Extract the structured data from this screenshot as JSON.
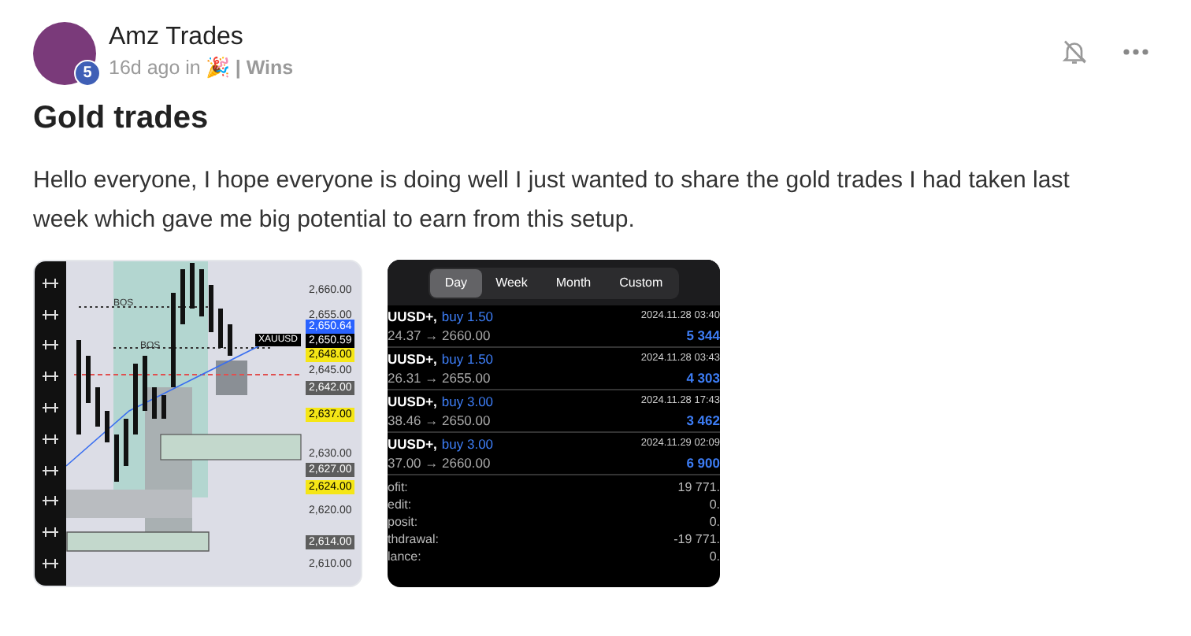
{
  "post": {
    "author": "Amz Trades",
    "level_badge": "5",
    "time": "16d ago in",
    "category_emoji": "🎉",
    "category": "| Wins",
    "title": "Gold trades",
    "body": "Hello everyone, I hope everyone is doing well I just wanted to share the gold trades I had taken last week which gave me big potential to earn from this setup."
  },
  "chart_image": {
    "annotations": [
      "BOS",
      "BOS"
    ],
    "symbol": "XAUUSD",
    "price_labels": [
      {
        "text": "2,660.00",
        "kind": "plain"
      },
      {
        "text": "2,655.00",
        "kind": "plain"
      },
      {
        "text": "2,650.64",
        "kind": "blue"
      },
      {
        "text": "2,650.59",
        "kind": "black"
      },
      {
        "text": "2,648.00",
        "kind": "yellow"
      },
      {
        "text": "2,645.00",
        "kind": "plain"
      },
      {
        "text": "2,642.00",
        "kind": "gray"
      },
      {
        "text": "2,637.00",
        "kind": "yellow"
      },
      {
        "text": "2,630.00",
        "kind": "plain"
      },
      {
        "text": "2,627.00",
        "kind": "gray"
      },
      {
        "text": "2,624.00",
        "kind": "yellow"
      },
      {
        "text": "2,620.00",
        "kind": "plain"
      },
      {
        "text": "2,614.00",
        "kind": "gray"
      },
      {
        "text": "2,610.00",
        "kind": "plain"
      }
    ]
  },
  "history_image": {
    "tabs": [
      {
        "label": "Day",
        "selected": true
      },
      {
        "label": "Week",
        "selected": false
      },
      {
        "label": "Month",
        "selected": false
      },
      {
        "label": "Custom",
        "selected": false
      }
    ],
    "trades": [
      {
        "symbol": "UUSD+,",
        "action": "buy 1.50",
        "time": "2024.11.28 03:40",
        "prices": "24.37 → 2660.00",
        "profit": "5 344"
      },
      {
        "symbol": "UUSD+,",
        "action": "buy 1.50",
        "time": "2024.11.28 03:43",
        "prices": "26.31 → 2655.00",
        "profit": "4 303"
      },
      {
        "symbol": "UUSD+,",
        "action": "buy 3.00",
        "time": "2024.11.28 17:43",
        "prices": "38.46 → 2650.00",
        "profit": "3 462"
      },
      {
        "symbol": "UUSD+,",
        "action": "buy 3.00",
        "time": "2024.11.29 02:09",
        "prices": "37.00 → 2660.00",
        "profit": "6 900"
      }
    ],
    "summary": [
      {
        "label": "ofit:",
        "value": "19 771."
      },
      {
        "label": "edit:",
        "value": "0."
      },
      {
        "label": "posit:",
        "value": "0."
      },
      {
        "label": "thdrawal:",
        "value": "-19 771."
      },
      {
        "label": "lance:",
        "value": "0."
      }
    ]
  }
}
